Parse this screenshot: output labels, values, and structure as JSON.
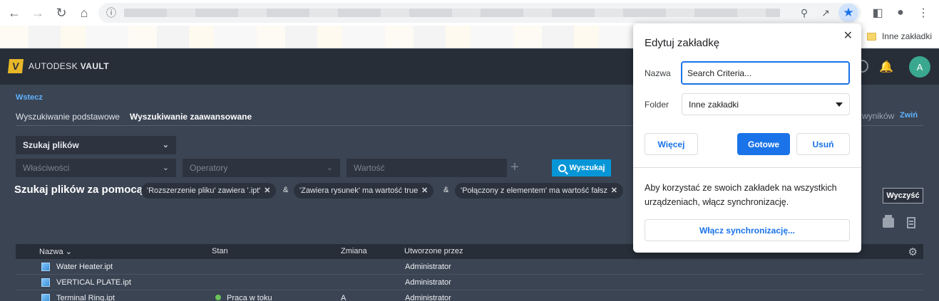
{
  "browser": {
    "bookmarks_bar": {
      "other_bookmarks": "Inne zakładki"
    }
  },
  "app": {
    "brand_prefix": "AUTODESK",
    "brand_name": "VAULT",
    "logo_letter": "V",
    "avatar_letter": "A"
  },
  "search": {
    "back_label": "Wstecz",
    "tabs": [
      "Wyszukiwanie podstawowe",
      "Wyszukiwanie zaawansowane"
    ],
    "results_label": "wyników",
    "collapse_label": "Zwiń",
    "scope_value": "Szukaj plików",
    "property_placeholder": "Właściwości",
    "operator_placeholder": "Operatory",
    "value_placeholder": "Wartość",
    "search_button": "Wyszukaj",
    "criteria_title": "Szukaj plików za pomocą",
    "criteria": [
      "'Rozszerzenie pliku' zawiera '.ipt'",
      "'Zawiera rysunek' ma wartość true",
      "'Połączony z elementem' ma wartość fałsz"
    ],
    "and_label": "&",
    "clear_button": "Wyczyść"
  },
  "table": {
    "columns": [
      "Nazwa",
      "Stan",
      "Zmiana",
      "Utworzone przez"
    ],
    "rows": [
      {
        "name": "Water Heater.ipt",
        "state": "",
        "revision": "",
        "created_by": "Administrator"
      },
      {
        "name": "VERTICAL PLATE.ipt",
        "state": "",
        "revision": "",
        "created_by": "Administrator"
      },
      {
        "name": "Terminal Ring.ipt",
        "state": "Praca w toku",
        "revision": "A",
        "created_by": "Administrator"
      }
    ]
  },
  "bookmark_popup": {
    "title": "Edytuj zakładkę",
    "name_label": "Nazwa",
    "name_value": "Search Criteria...",
    "folder_label": "Folder",
    "folder_value": "Inne zakładki",
    "more_button": "Więcej",
    "done_button": "Gotowe",
    "remove_button": "Usuń",
    "sync_text": "Aby korzystać ze swoich zakładek na wszystkich urządzeniach, włącz synchronizację.",
    "sync_button": "Włącz synchronizację..."
  },
  "colors": {
    "accent_blue": "#1a73e8",
    "vault_blue": "#0696d7",
    "vault_bg": "#3b4453",
    "vault_header": "#272e38"
  }
}
